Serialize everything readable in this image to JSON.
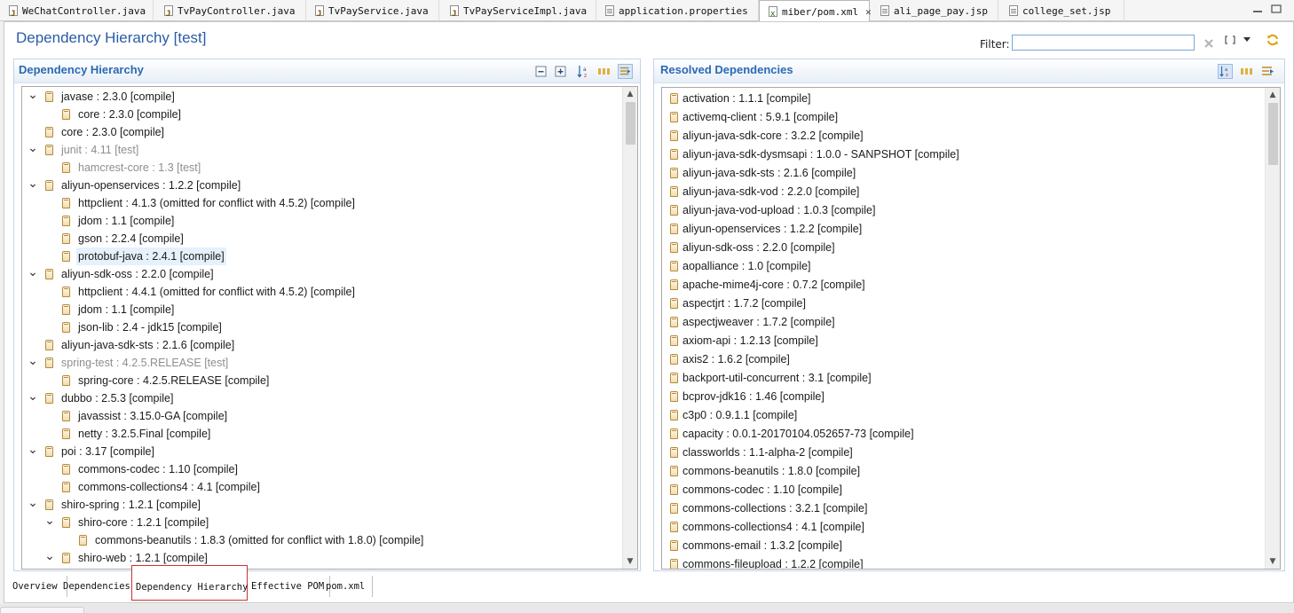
{
  "editor_tabs": [
    {
      "label": "WeChatController.java",
      "icon": "java-file-icon"
    },
    {
      "label": "TvPayController.java",
      "icon": "java-file-icon"
    },
    {
      "label": "TvPayService.java",
      "icon": "java-file-icon"
    },
    {
      "label": "TvPayServiceImpl.java",
      "icon": "java-file-icon"
    },
    {
      "label": "application.properties",
      "icon": "properties-file-icon"
    },
    {
      "label": "miber/pom.xml",
      "icon": "xml-file-icon",
      "active": true
    },
    {
      "label": "ali_page_pay.jsp",
      "icon": "jsp-file-icon"
    },
    {
      "label": "college_set.jsp",
      "icon": "jsp-file-icon"
    }
  ],
  "header": {
    "title": "Dependency Hierarchy [test]",
    "filter_label": "Filter:",
    "filter_value": ""
  },
  "hierarchy": {
    "title": "Dependency Hierarchy",
    "rows": [
      {
        "label": "javase : 2.3.0 [compile]",
        "depth": 0,
        "expanded": true
      },
      {
        "label": "core : 2.3.0 [compile]",
        "depth": 1
      },
      {
        "label": "core : 2.3.0 [compile]",
        "depth": 0
      },
      {
        "label": "junit : 4.11 [test]",
        "depth": 0,
        "expanded": true,
        "muted": true
      },
      {
        "label": "hamcrest-core : 1.3 [test]",
        "depth": 1,
        "muted": true
      },
      {
        "label": "aliyun-openservices : 1.2.2 [compile]",
        "depth": 0,
        "expanded": true
      },
      {
        "label": "httpclient : 4.1.3 (omitted for conflict with 4.5.2) [compile]",
        "depth": 1
      },
      {
        "label": "jdom : 1.1 [compile]",
        "depth": 1
      },
      {
        "label": "gson : 2.2.4 [compile]",
        "depth": 1
      },
      {
        "label": "protobuf-java : 2.4.1 [compile]",
        "depth": 1,
        "selected": true
      },
      {
        "label": "aliyun-sdk-oss : 2.2.0 [compile]",
        "depth": 0,
        "expanded": true
      },
      {
        "label": "httpclient : 4.4.1 (omitted for conflict with 4.5.2) [compile]",
        "depth": 1
      },
      {
        "label": "jdom : 1.1 [compile]",
        "depth": 1
      },
      {
        "label": "json-lib : 2.4 - jdk15 [compile]",
        "depth": 1
      },
      {
        "label": "aliyun-java-sdk-sts : 2.1.6 [compile]",
        "depth": 0
      },
      {
        "label": "spring-test : 4.2.5.RELEASE [test]",
        "depth": 0,
        "expanded": true,
        "muted": true
      },
      {
        "label": "spring-core : 4.2.5.RELEASE [compile]",
        "depth": 1
      },
      {
        "label": "dubbo : 2.5.3 [compile]",
        "depth": 0,
        "expanded": true
      },
      {
        "label": "javassist : 3.15.0-GA [compile]",
        "depth": 1
      },
      {
        "label": "netty : 3.2.5.Final [compile]",
        "depth": 1
      },
      {
        "label": "poi : 3.17 [compile]",
        "depth": 0,
        "expanded": true
      },
      {
        "label": "commons-codec : 1.10 [compile]",
        "depth": 1
      },
      {
        "label": "commons-collections4 : 4.1 [compile]",
        "depth": 1
      },
      {
        "label": "shiro-spring : 1.2.1 [compile]",
        "depth": 0,
        "expanded": true
      },
      {
        "label": "shiro-core : 1.2.1 [compile]",
        "depth": 1,
        "expanded": true
      },
      {
        "label": "commons-beanutils : 1.8.3 (omitted for conflict with 1.8.0) [compile]",
        "depth": 2
      },
      {
        "label": "shiro-web : 1.2.1 [compile]",
        "depth": 1,
        "expanded": true
      }
    ]
  },
  "resolved": {
    "title": "Resolved Dependencies",
    "rows": [
      "activation : 1.1.1 [compile]",
      "activemq-client : 5.9.1 [compile]",
      "aliyun-java-sdk-core : 3.2.2 [compile]",
      "aliyun-java-sdk-dysmsapi : 1.0.0 - SANPSHOT [compile]",
      "aliyun-java-sdk-sts : 2.1.6 [compile]",
      "aliyun-java-sdk-vod : 2.2.0 [compile]",
      "aliyun-java-vod-upload : 1.0.3 [compile]",
      "aliyun-openservices : 1.2.2 [compile]",
      "aliyun-sdk-oss : 2.2.0 [compile]",
      "aopalliance : 1.0 [compile]",
      "apache-mime4j-core : 0.7.2 [compile]",
      "aspectjrt : 1.7.2 [compile]",
      "aspectjweaver : 1.7.2 [compile]",
      "axiom-api : 1.2.13 [compile]",
      "axis2 : 1.6.2 [compile]",
      "backport-util-concurrent : 3.1 [compile]",
      "bcprov-jdk16 : 1.46 [compile]",
      "c3p0 : 0.9.1.1 [compile]",
      "capacity : 0.0.1-20170104.052657-73 [compile]",
      "classworlds : 1.1-alpha-2 [compile]",
      "commons-beanutils : 1.8.0 [compile]",
      "commons-codec : 1.10 [compile]",
      "commons-collections : 3.2.1 [compile]",
      "commons-collections4 : 4.1 [compile]",
      "commons-email : 1.3.2 [compile]",
      "commons-fileupload : 1.2.2 [compile]"
    ]
  },
  "page_tabs": [
    {
      "label": "Overview"
    },
    {
      "label": "Dependencies"
    },
    {
      "label": "Dependency Hierarchy",
      "active": true
    },
    {
      "label": "Effective POM"
    },
    {
      "label": "pom.xml"
    }
  ],
  "colors": {
    "title_blue": "#2a5ca4",
    "section_title_blue": "#2a6ab4",
    "highlight_red": "#c83232",
    "selection_bg": "#e5f1fb"
  }
}
